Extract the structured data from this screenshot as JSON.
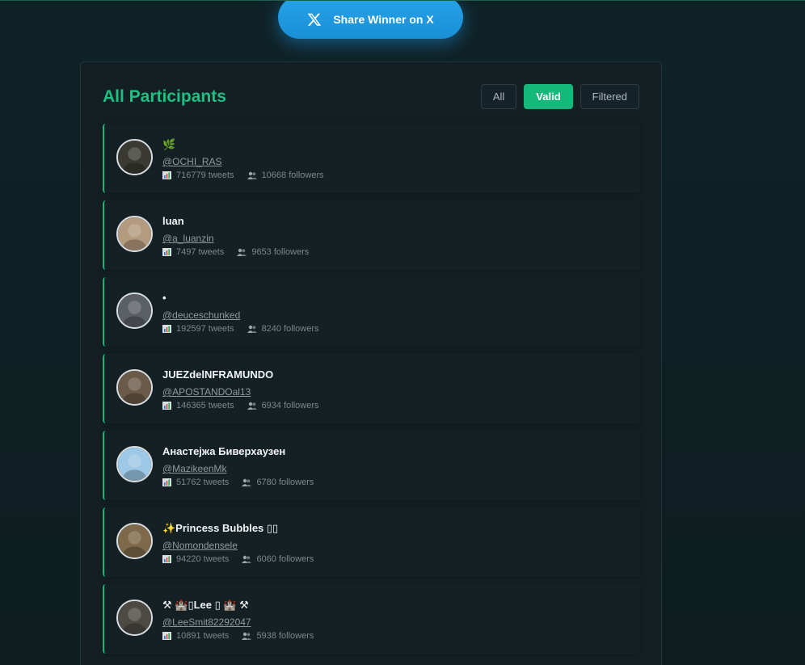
{
  "share": {
    "label": "Share Winner on X",
    "icon": "x-logo-icon"
  },
  "panel": {
    "title": "All Participants",
    "filters": [
      {
        "label": "All",
        "active": false
      },
      {
        "label": "Valid",
        "active": true
      },
      {
        "label": "Filtered",
        "active": false
      }
    ]
  },
  "participants": [
    {
      "name": "🌿",
      "handle": "@OCHI_RAS",
      "tweets": "716779 tweets",
      "followers": "10668 followers",
      "avatar_color": "#3a3a32"
    },
    {
      "name": "luan",
      "handle": "@a_luanzin",
      "tweets": "7497 tweets",
      "followers": "9653 followers",
      "avatar_color": "#b49a7e"
    },
    {
      "name": "•",
      "handle": "@deuceschunked",
      "tweets": "192597 tweets",
      "followers": "8240 followers",
      "avatar_color": "#5b6066"
    },
    {
      "name": "JUEZdelNFRAMUNDO",
      "handle": "@APOSTANDOal13",
      "tweets": "146365 tweets",
      "followers": "6934 followers",
      "avatar_color": "#6b5a48"
    },
    {
      "name": "Анастејжа Биверхаузен",
      "handle": "@MazikeenMk",
      "tweets": "51762 tweets",
      "followers": "6780 followers",
      "avatar_color": "#9ec9e6"
    },
    {
      "name": "✨Princess Bubbles ▯▯",
      "handle": "@Nomondensele",
      "tweets": "94220 tweets",
      "followers": "6060 followers",
      "avatar_color": "#7e6a4a"
    },
    {
      "name": "⚒ 🏰▯Lee ▯ 🏰 ⚒",
      "handle": "@LeeSmit82292047",
      "tweets": "10891 tweets",
      "followers": "5938 followers",
      "avatar_color": "#4d4a44"
    }
  ]
}
